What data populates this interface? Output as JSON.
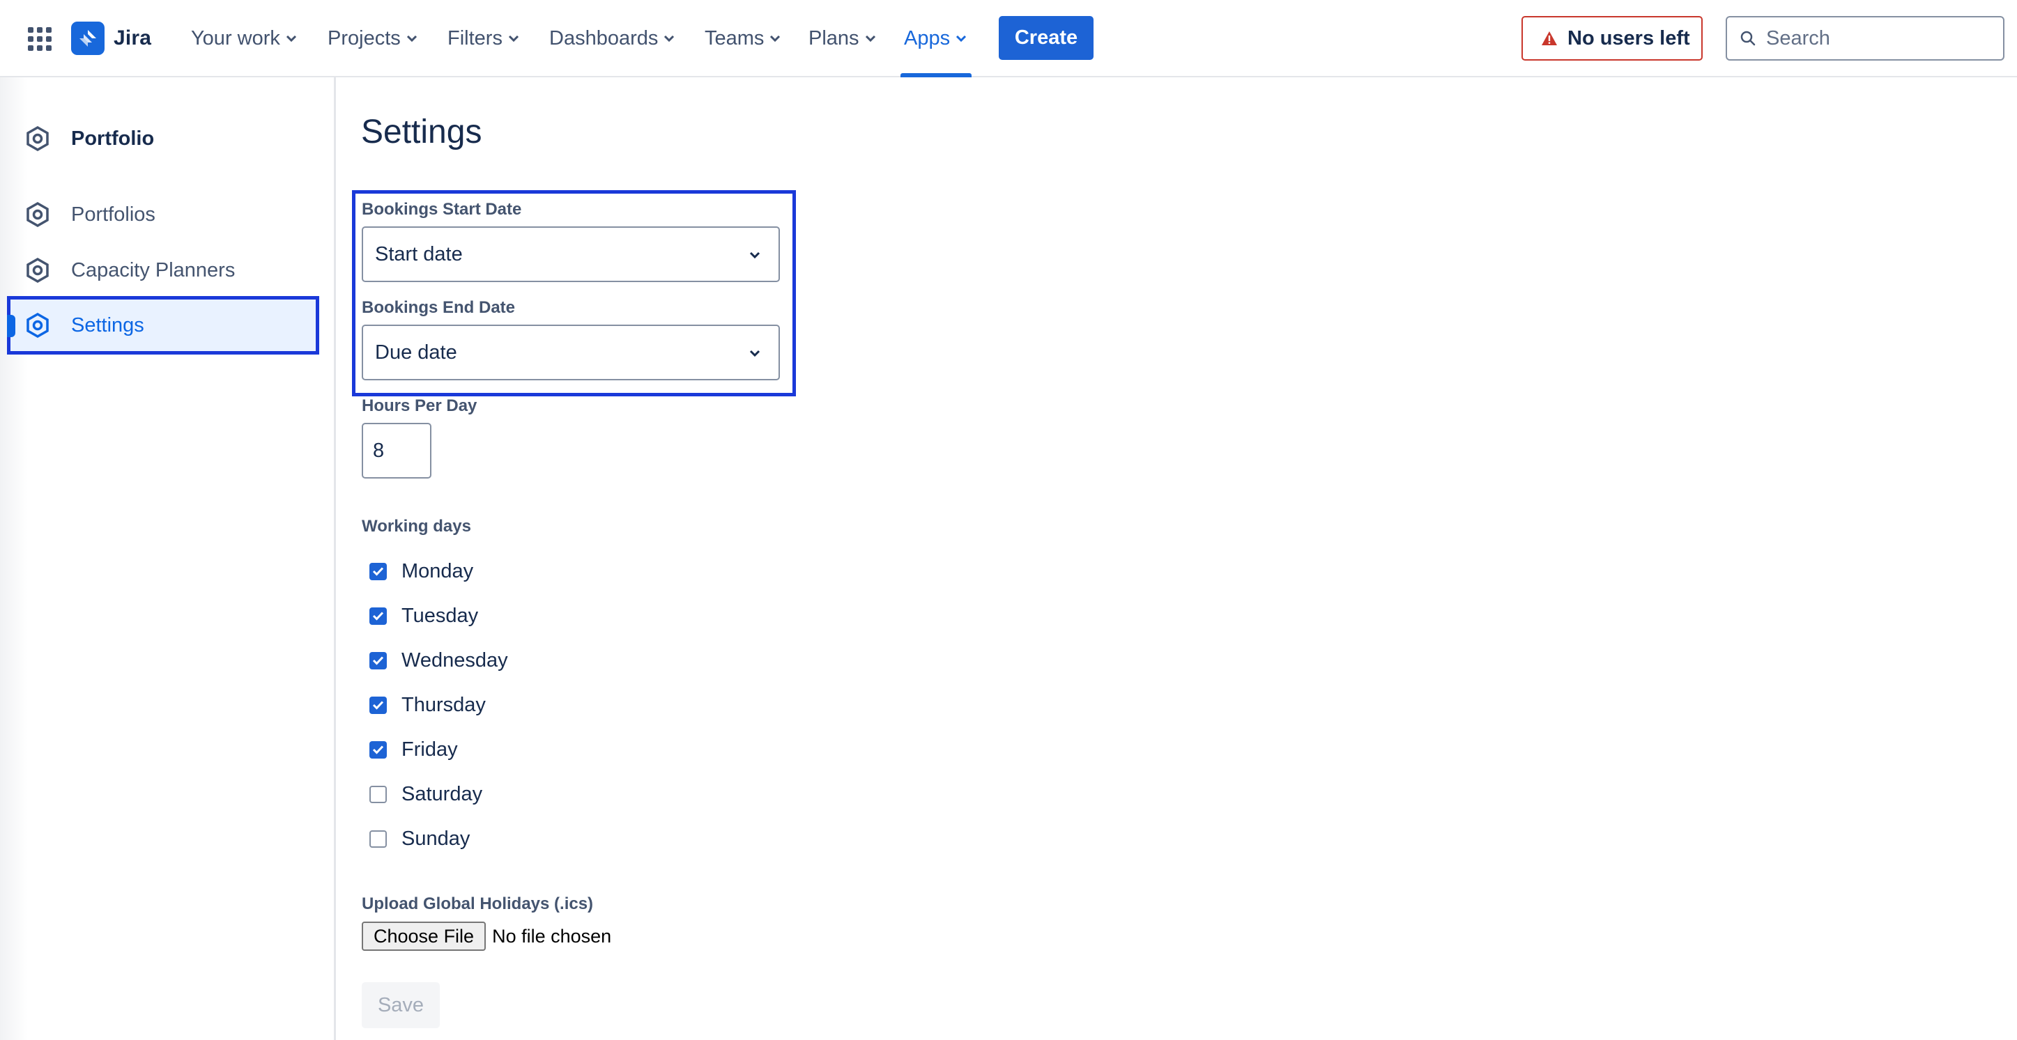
{
  "nav": {
    "app_name": "Jira",
    "items": [
      {
        "label": "Your work"
      },
      {
        "label": "Projects"
      },
      {
        "label": "Filters"
      },
      {
        "label": "Dashboards"
      },
      {
        "label": "Teams"
      },
      {
        "label": "Plans"
      },
      {
        "label": "Apps"
      }
    ],
    "active_item": "Apps",
    "create_label": "Create",
    "users_badge": "No users left",
    "search_placeholder": "Search"
  },
  "sidebar": {
    "header": "Portfolio",
    "items": [
      {
        "label": "Portfolios",
        "icon": "hexagon-icon"
      },
      {
        "label": "Capacity Planners",
        "icon": "hexagon-icon"
      },
      {
        "label": "Settings",
        "icon": "hexagon-icon",
        "selected": true
      }
    ]
  },
  "settings": {
    "title": "Settings",
    "start_date": {
      "label": "Bookings Start Date",
      "value": "Start date"
    },
    "end_date": {
      "label": "Bookings End Date",
      "value": "Due date"
    },
    "hours_per_day": {
      "label": "Hours Per Day",
      "value": "8"
    },
    "working_days": {
      "label": "Working days",
      "days": [
        {
          "name": "Monday",
          "checked": true
        },
        {
          "name": "Tuesday",
          "checked": true
        },
        {
          "name": "Wednesday",
          "checked": true
        },
        {
          "name": "Thursday",
          "checked": true
        },
        {
          "name": "Friday",
          "checked": true
        },
        {
          "name": "Saturday",
          "checked": false
        },
        {
          "name": "Sunday",
          "checked": false
        }
      ]
    },
    "holidays": {
      "label": "Upload Global Holidays (.ics)",
      "button_label": "Choose File",
      "status": "No file chosen"
    },
    "save_label": "Save"
  },
  "colors": {
    "accent": "#1d63d5",
    "highlight_border": "#1a39d9",
    "warning": "#c9372c"
  }
}
